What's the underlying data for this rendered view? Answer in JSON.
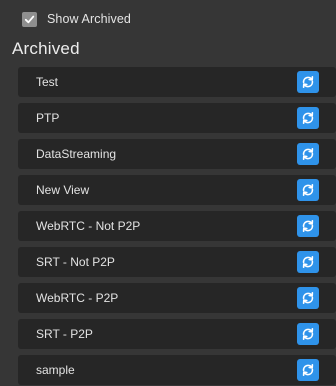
{
  "toggle": {
    "label": "Show Archived",
    "checked": true
  },
  "section": {
    "title": "Archived"
  },
  "items": [
    {
      "label": "Test",
      "action_icon": "restore-icon"
    },
    {
      "label": "PTP",
      "action_icon": "restore-icon"
    },
    {
      "label": "DataStreaming",
      "action_icon": "restore-icon"
    },
    {
      "label": "New View",
      "action_icon": "restore-icon"
    },
    {
      "label": "WebRTC - Not P2P",
      "action_icon": "restore-icon"
    },
    {
      "label": "SRT - Not P2P",
      "action_icon": "restore-icon"
    },
    {
      "label": "WebRTC - P2P",
      "action_icon": "restore-icon"
    },
    {
      "label": "SRT - P2P",
      "action_icon": "restore-icon"
    },
    {
      "label": "sample",
      "action_icon": "restore-icon"
    }
  ],
  "colors": {
    "background": "#363636",
    "row_background": "#262626",
    "accent": "#2f93ea",
    "checkbox": "#8f8f8f"
  }
}
